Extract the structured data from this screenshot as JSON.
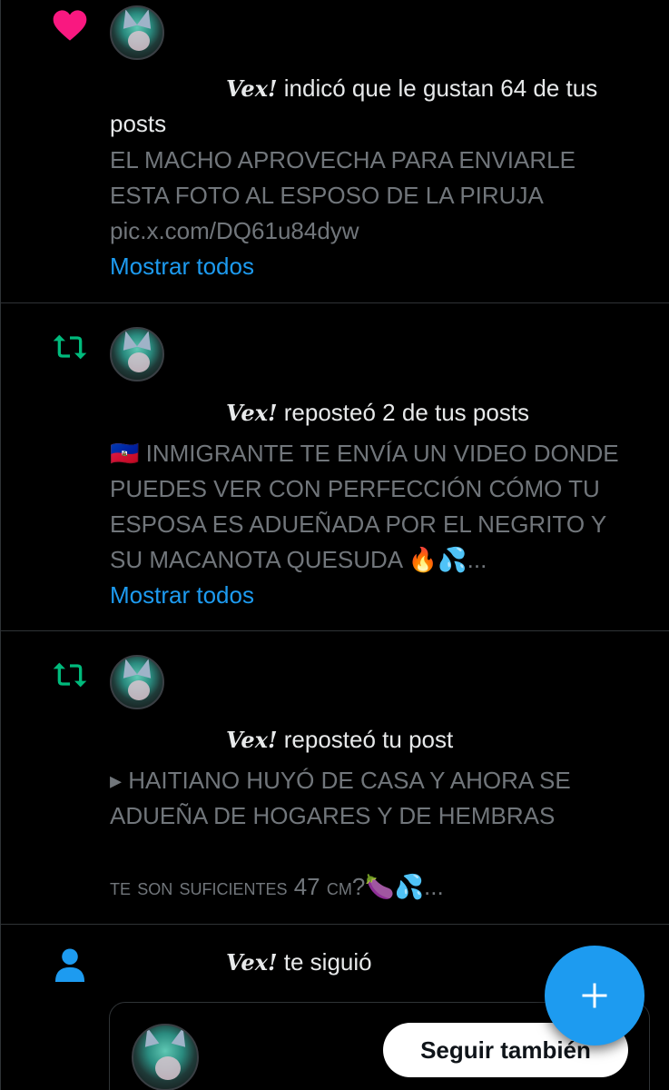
{
  "notifications": [
    {
      "type": "like",
      "user": "Vex!",
      "action": "indicó que le gustan 64 de tus",
      "action_cont": "posts",
      "body_line1": "EL MACHO APROVECHA PARA ENVIARLE",
      "body_line2": "ESTA FOTO AL ESPOSO DE LA PIRUJA",
      "body_line3": "pic.x.com/DQ61u84dyw",
      "show_all": "Mostrar todos"
    },
    {
      "type": "repost",
      "user": "Vex!",
      "action": "reposteó 2 de tus posts",
      "body_line1": "🇭🇹 INMIGRANTE TE ENVÍA UN VIDEO DONDE",
      "body_line2": "PUEDES VER CON PERFECCIÓN CÓMO TU",
      "body_line3": "ESPOSA ES ADUEÑADA POR EL NEGRITO Y",
      "body_line4": "SU MACANOTA QUESUDA 🔥💦...",
      "show_all": "Mostrar todos"
    },
    {
      "type": "repost",
      "user": "Vex!",
      "action": "reposteó tu post",
      "body_line1": "▸  HAITIANO HUYÓ DE CASA Y AHORA SE",
      "body_line2": "ADUEÑA DE HOGARES Y DE HEMBRAS",
      "body_line3": "te son suficientes 47 cm?🍆💦..."
    },
    {
      "type": "follow",
      "user": "Vex!",
      "action": "te siguió",
      "follow_back": "Seguir también"
    }
  ],
  "colors": {
    "like": "#f91880",
    "repost": "#00ba7c",
    "follow": "#1d9bf0",
    "link": "#1d9bf0",
    "muted_text": "#71767b"
  },
  "icons": {
    "like": "heart-icon",
    "repost": "repost-icon",
    "follow": "person-icon",
    "fab": "plus-icon"
  }
}
